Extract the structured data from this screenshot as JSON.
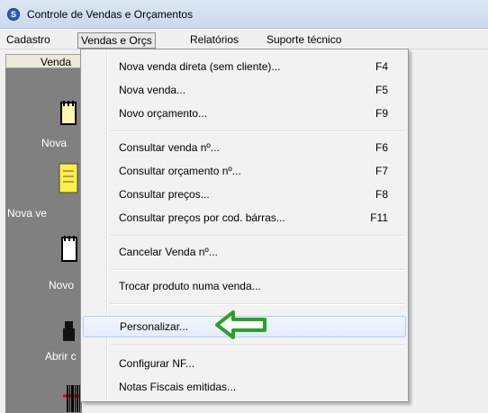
{
  "window": {
    "title": "Controle de Vendas e Orçamentos",
    "icon": "app-s-icon"
  },
  "menubar": {
    "items": [
      {
        "label": "Cadastro"
      },
      {
        "label": "Vendas e Orçs"
      },
      {
        "label": "Relatórios"
      },
      {
        "label": "Suporte técnico"
      }
    ]
  },
  "panel": {
    "header": "Venda",
    "buttons": [
      {
        "label": "Nova",
        "icon": "notepad-icon"
      },
      {
        "label": "Nova ve",
        "icon": "notepad-yellow-icon"
      },
      {
        "label": "Novo",
        "icon": "document-icon"
      },
      {
        "label": "Abrir c",
        "icon": "cash-drawer-icon"
      },
      {
        "label": "",
        "icon": "barcode-icon"
      }
    ]
  },
  "dropdown": {
    "items": [
      {
        "label": "Nova venda direta (sem cliente)...",
        "shortcut": "F4"
      },
      {
        "label": "Nova venda...",
        "shortcut": "F5"
      },
      {
        "label": "Novo orçamento...",
        "shortcut": "F9"
      },
      {
        "label": "Consultar venda nº...",
        "shortcut": "F6"
      },
      {
        "label": "Consultar orçamento nº...",
        "shortcut": "F7"
      },
      {
        "label": "Consultar preços...",
        "shortcut": "F8"
      },
      {
        "label": "Consultar preços por cod. bárras...",
        "shortcut": "F11"
      },
      {
        "label": "Cancelar Venda nº...",
        "shortcut": ""
      },
      {
        "label": "Trocar produto numa venda...",
        "shortcut": ""
      },
      {
        "label": "Personalizar...",
        "shortcut": ""
      },
      {
        "label": "Configurar NF...",
        "shortcut": ""
      },
      {
        "label": "Notas Fiscais emitidas...",
        "shortcut": ""
      }
    ],
    "highlighted_item": "Personalizar...",
    "annotation_arrow_color": "#2aa22a"
  },
  "colors": {
    "panel_bg": "#808080",
    "highlight_border": "#aecff7",
    "arrow": "#2aa22a"
  }
}
